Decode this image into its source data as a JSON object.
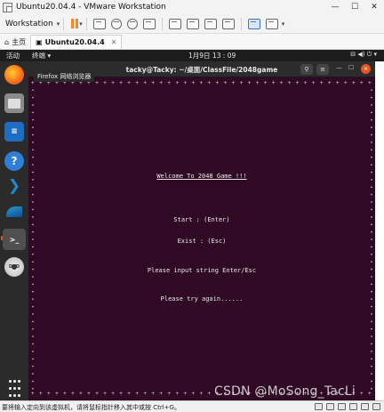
{
  "window": {
    "title": "Ubuntu20.04.4 - VMware Workstation",
    "minimize_glyph": "—",
    "maximize_glyph": "☐",
    "close_glyph": "✕"
  },
  "toolbar": {
    "workstation_label": "Workstation",
    "menu_caret": "▾",
    "accent_color": "#f08a24"
  },
  "tabs": [
    {
      "label": "主页",
      "active": false
    },
    {
      "label": "Ubuntu20.04.4",
      "active": true,
      "close_glyph": "✕"
    }
  ],
  "ubuntu_topbar": {
    "activities": "活动",
    "app_menu": "终端 ▾",
    "clock": "1月9日 13 : 09",
    "system_icons": "⊟ ◀) ⏻ ▾"
  },
  "dock": {
    "tooltip": "Firefox 网络浏览器",
    "items": [
      "firefox-icon",
      "files-icon",
      "writer-icon",
      "help-icon",
      "vscode-icon",
      "wireshark-icon",
      "terminal-icon",
      "dvd-icon",
      "show-apps-icon"
    ],
    "help_glyph": "?",
    "vscode_glyph": "❯",
    "terminal_glyph": ">_",
    "dvd_label": "DVD"
  },
  "terminal": {
    "title": "tacky@Tacky: ~/桌面/ClassFile/2048game",
    "search_glyph": "⚲",
    "menu_glyph": "≡",
    "min_glyph": "—",
    "max_glyph": "☐",
    "close_glyph": "✕",
    "border_row": "+ + + + + + + + + + + + + + + + + + + + + + + + + + + + + + + + + + + + + + + + + + + + + + + + + + + + + + + + + + + + + + + + + +",
    "lines": {
      "welcome": "Welcome To 2048 Game !!!",
      "start": "Start : (Enter)",
      "exit": "Exist : (Esc)",
      "input": "Please input string Enter/Esc",
      "try": "Please try again......"
    },
    "background_color": "#300a24"
  },
  "statusbar": {
    "message": "要将输入定向到该虚拟机，请将鼠标指针移入其中或按 Ctrl+G。"
  },
  "watermark": "CSDN @MoSong_TacLi"
}
